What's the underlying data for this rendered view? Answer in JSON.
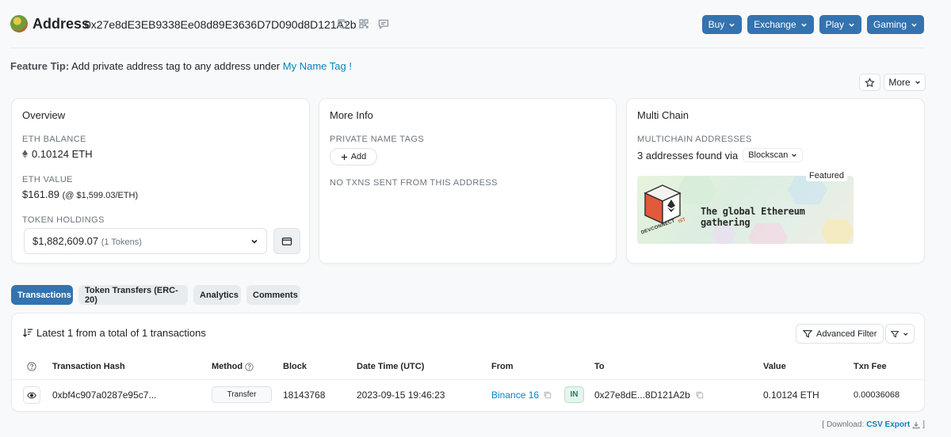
{
  "header": {
    "title": "Address",
    "address": "0x27e8dE3EB9338Ee08d89E3636D7D090d8D121A2b",
    "nav_buttons": [
      {
        "label": "Buy"
      },
      {
        "label": "Exchange"
      },
      {
        "label": "Play"
      },
      {
        "label": "Gaming"
      }
    ]
  },
  "tip": {
    "prefix": "Feature Tip:",
    "text": "Add private address tag to any address under",
    "link": "My Name Tag",
    "suffix": "!"
  },
  "actions": {
    "more_label": "More"
  },
  "overview": {
    "title": "Overview",
    "eth_balance_label": "ETH BALANCE",
    "eth_balance": "0.10124 ETH",
    "eth_value_label": "ETH VALUE",
    "eth_value": "$161.89",
    "eth_price": "(@ $1,599.03/ETH)",
    "token_holdings_label": "TOKEN HOLDINGS",
    "token_value": "$1,882,609.07",
    "token_count": "(1 Tokens)"
  },
  "more_info": {
    "title": "More Info",
    "private_tags_label": "PRIVATE NAME TAGS",
    "add_label": "Add",
    "no_txns": "NO TXNS SENT FROM THIS ADDRESS"
  },
  "multi_chain": {
    "title": "Multi Chain",
    "label": "MULTICHAIN ADDRESSES",
    "found_text": "3 addresses found via",
    "blockscan": "Blockscan",
    "featured": "Featured",
    "banner_text": "The global Ethereum gathering",
    "banner_brand": "DEVCONNECT",
    "banner_brand_2": "IST"
  },
  "tabs": [
    {
      "label": "Transactions",
      "active": true
    },
    {
      "label": "Token Transfers (ERC-20)",
      "active": false
    },
    {
      "label": "Analytics",
      "active": false
    },
    {
      "label": "Comments",
      "active": false
    }
  ],
  "transactions": {
    "summary": "Latest 1 from a total of 1 transactions",
    "advanced_filter": "Advanced Filter",
    "columns": {
      "hash": "Transaction Hash",
      "method": "Method",
      "block": "Block",
      "datetime": "Date Time (UTC)",
      "from": "From",
      "to": "To",
      "value": "Value",
      "fee": "Txn Fee"
    },
    "rows": [
      {
        "hash": "0xbf4c907a0287e95c7...",
        "method": "Transfer",
        "block": "18143768",
        "datetime": "2023-09-15 19:46:23",
        "from": "Binance 16",
        "direction": "IN",
        "to": "0x27e8dE...8D121A2b",
        "value": "0.10124 ETH",
        "fee": "0.00036068"
      }
    ]
  },
  "download": {
    "prefix": "[ Download:",
    "link": "CSV Export",
    "suffix": "]"
  },
  "colors": {
    "accent": "#3373b0",
    "link": "#0784c3"
  }
}
